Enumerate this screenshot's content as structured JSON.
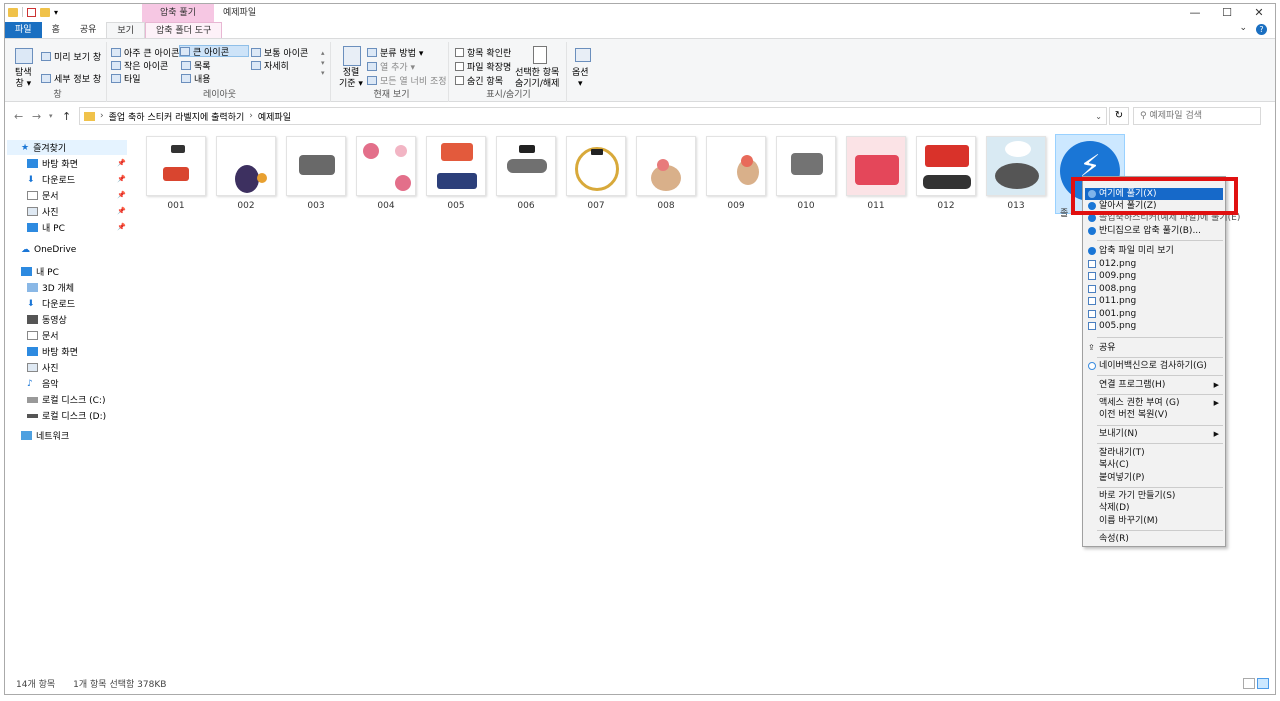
{
  "window": {
    "context_tab": "압축 풀기",
    "title": "예제파일",
    "controls": [
      "—",
      "☐",
      "✕"
    ]
  },
  "ribbon_tabs": [
    "파일",
    "홈",
    "공유",
    "보기",
    "압축 폴더 도구"
  ],
  "ribbon": {
    "pane": {
      "nav_pane": "탐색\n창 ▾",
      "preview": "미리 보기 창",
      "details": "세부 정보 창",
      "label": "창"
    },
    "layout": {
      "items": [
        "아주 큰 아이콘",
        "큰 아이콘",
        "보통 아이콘",
        "작은 아이콘",
        "목록",
        "자세히",
        "타일",
        "내용"
      ],
      "label": "레이아웃"
    },
    "current_view": {
      "sort": "정렬\n기준 ▾",
      "group": "분류 방법 ▾",
      "add_col": "열 추가 ▾",
      "fit_cols": "모든 열 너비 조정",
      "label": "현재 보기"
    },
    "show_hide": {
      "checkbox": "항목 확인란",
      "ext": "파일 확장명",
      "hidden": "숨긴 항목",
      "hide_sel": "선택한 항목\n숨기기/해제",
      "label": "표시/숨기기"
    },
    "options": {
      "label": "옵션\n▾"
    }
  },
  "address": {
    "path": [
      "졸업 축하 스티커 라벨지에 출력하기",
      "예제파일"
    ],
    "search_placeholder": "예제파일 검색"
  },
  "nav": {
    "quick_access": "즐겨찾기",
    "quick_items": [
      "바탕 화면",
      "다운로드",
      "문서",
      "사진",
      "내 PC"
    ],
    "onedrive": "OneDrive",
    "this_pc": "내 PC",
    "pc_items": [
      "3D 개체",
      "다운로드",
      "동영상",
      "문서",
      "바탕 화면",
      "사진",
      "음악",
      "로컬 디스크 (C:)",
      "로컬 디스크 (D:)"
    ],
    "network": "네트워크"
  },
  "files": [
    "001",
    "002",
    "003",
    "004",
    "005",
    "006",
    "007",
    "008",
    "009",
    "010",
    "011",
    "012",
    "013"
  ],
  "selected_file_label": "졸",
  "status": {
    "count": "14개 항목",
    "selected": "1개 항목 선택함 378KB"
  },
  "context_menu": {
    "items": [
      "여기에 풀기(X)",
      "알아서 풀기(Z)",
      "졸업축하스티커(예제 파일)에 풀기(E)",
      "반디집으로 압축 풀기(B)...",
      "압축 파일 미리 보기",
      "012.png",
      "009.png",
      "008.png",
      "011.png",
      "001.png",
      "005.png",
      "공유",
      "네이버백신으로 검사하기(G)",
      "연결 프로그램(H)",
      "액세스 권한 부여 (G)",
      "이전 버전 복원(V)",
      "보내기(N)",
      "잘라내기(T)",
      "복사(C)",
      "붙여넣기(P)",
      "바로 가기 만들기(S)",
      "삭제(D)",
      "이름 바꾸기(M)",
      "속성(R)"
    ]
  },
  "colors": {
    "accent": "#1669c9",
    "highlight_box": "#e01010",
    "context_tab": "#f6c7e3"
  }
}
